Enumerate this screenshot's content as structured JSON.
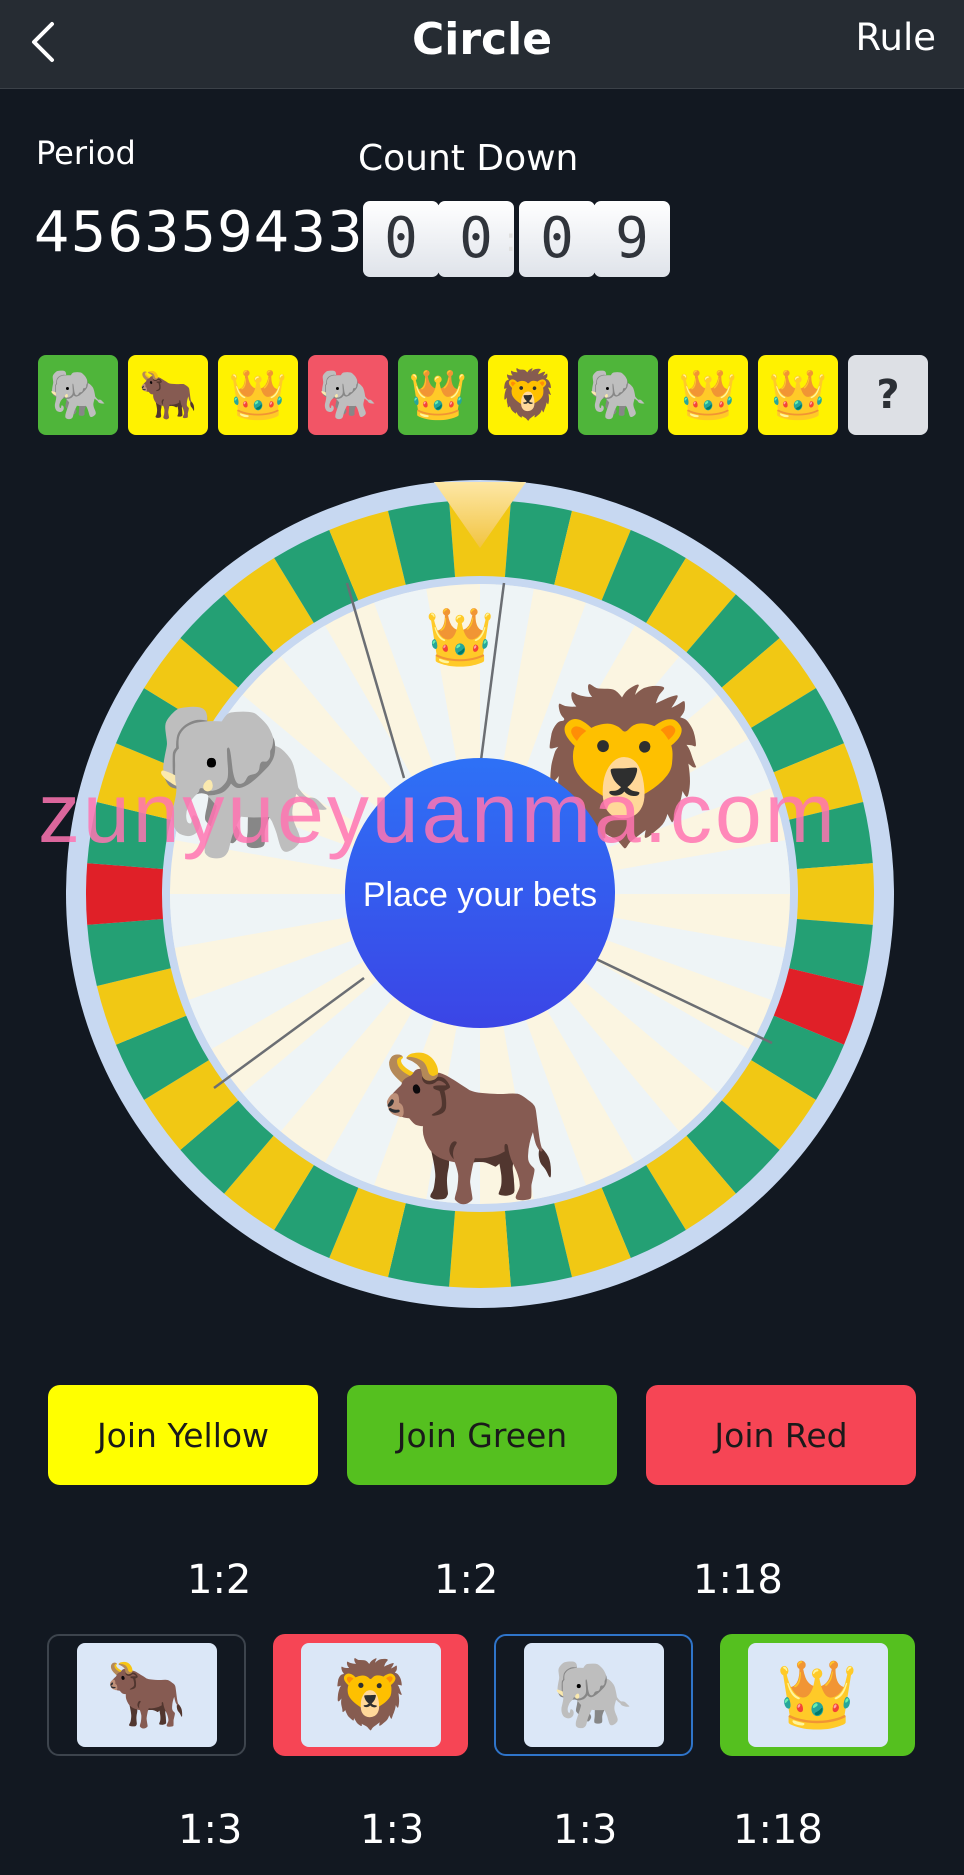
{
  "header": {
    "title": "Circle",
    "rule_label": "Rule",
    "back_icon": "chevron-left-icon"
  },
  "period": {
    "label": "Period",
    "value": "4563594332"
  },
  "countdown": {
    "label": "Count Down",
    "digits": [
      "0",
      "0",
      "0",
      "9"
    ],
    "separator": ":"
  },
  "history": [
    {
      "animal": "elephant",
      "color": "green",
      "emoji": "🐘"
    },
    {
      "animal": "cow",
      "color": "yellow",
      "emoji": "🐂"
    },
    {
      "animal": "crown",
      "color": "yellow",
      "emoji": "👑"
    },
    {
      "animal": "elephant",
      "color": "red",
      "emoji": "🐘"
    },
    {
      "animal": "crown",
      "color": "green",
      "emoji": "👑"
    },
    {
      "animal": "lion",
      "color": "yellow",
      "emoji": "🦁"
    },
    {
      "animal": "elephant",
      "color": "green",
      "emoji": "🐘"
    },
    {
      "animal": "crown",
      "color": "yellow",
      "emoji": "👑"
    },
    {
      "animal": "crown",
      "color": "yellow",
      "emoji": "👑"
    },
    {
      "animal": "unknown",
      "color": "gray",
      "emoji": "?"
    }
  ],
  "wheel": {
    "center_text": "Place your bets",
    "items": [
      {
        "name": "crown",
        "emoji": "👑"
      },
      {
        "name": "lion",
        "emoji": "🦁"
      },
      {
        "name": "cow",
        "emoji": "🐂"
      },
      {
        "name": "elephant",
        "emoji": "🐘"
      }
    ]
  },
  "join_buttons": [
    {
      "label": "Join Yellow",
      "color": "#ffff00"
    },
    {
      "label": "Join Green",
      "color": "#55c01f"
    },
    {
      "label": "Join Red",
      "color": "#f64555"
    }
  ],
  "ratios_top": [
    "1:2",
    "1:2",
    "1:18"
  ],
  "bet_cards": [
    {
      "animal": "cow",
      "emoji": "🐂",
      "ratio": "1:3"
    },
    {
      "animal": "lion",
      "emoji": "🦁",
      "ratio": "1:3"
    },
    {
      "animal": "elephant",
      "emoji": "🐘",
      "ratio": "1:3"
    },
    {
      "animal": "crown",
      "emoji": "👑",
      "ratio": "1:18"
    }
  ],
  "watermark": "zunyueyuanma.com",
  "colors": {
    "background": "#121821",
    "header": "#262c33",
    "yellow": "#f1c814",
    "green": "#24a074",
    "red": "#e02028",
    "wheel_rim": "#c7d8f1",
    "center": "#2d5ef0"
  }
}
